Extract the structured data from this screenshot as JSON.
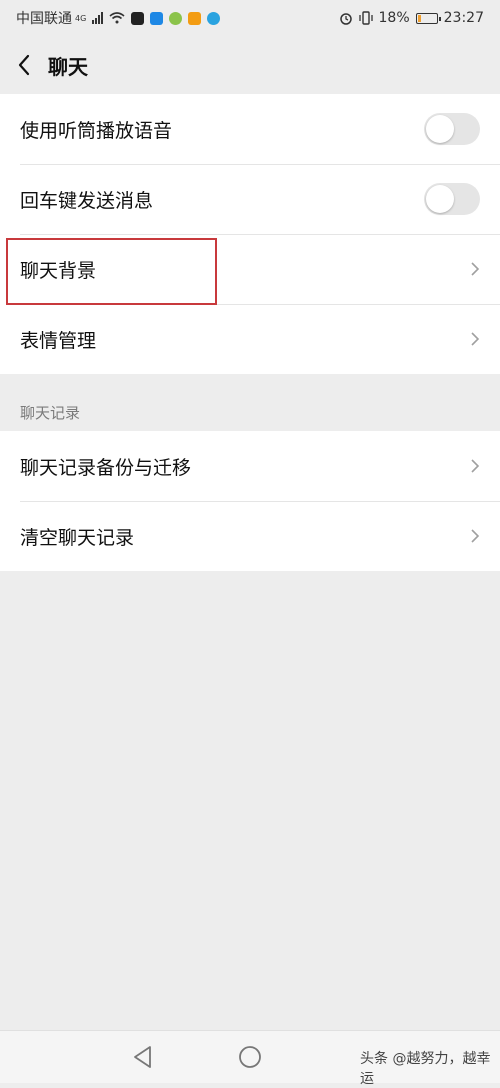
{
  "status_bar": {
    "carrier": "中国联通",
    "network": "4G",
    "battery_percent": "18%",
    "battery_level": 0.18,
    "time": "23:27",
    "icons": [
      "signal-icon",
      "wifi-icon",
      "capcut-icon",
      "app-icon-blue",
      "app-icon-green",
      "app-icon-orange",
      "telegram-icon",
      "alarm-icon",
      "vibrate-icon",
      "battery-icon"
    ]
  },
  "header": {
    "title": "聊天",
    "back_icon": "chevron-left-icon"
  },
  "settings": {
    "rows": [
      {
        "label": "使用听筒播放语音",
        "control": "toggle",
        "on": false
      },
      {
        "label": "回车键发送消息",
        "control": "toggle",
        "on": false
      },
      {
        "label": "聊天背景",
        "control": "chevron"
      },
      {
        "label": "表情管理",
        "control": "chevron"
      }
    ]
  },
  "history": {
    "section_label": "聊天记录",
    "rows": [
      {
        "label": "聊天记录备份与迁移",
        "control": "chevron"
      },
      {
        "label": "清空聊天记录",
        "control": "chevron"
      }
    ]
  },
  "annotation": {
    "color": "#c8393c"
  },
  "watermark": "头条 @越努力，越幸运"
}
